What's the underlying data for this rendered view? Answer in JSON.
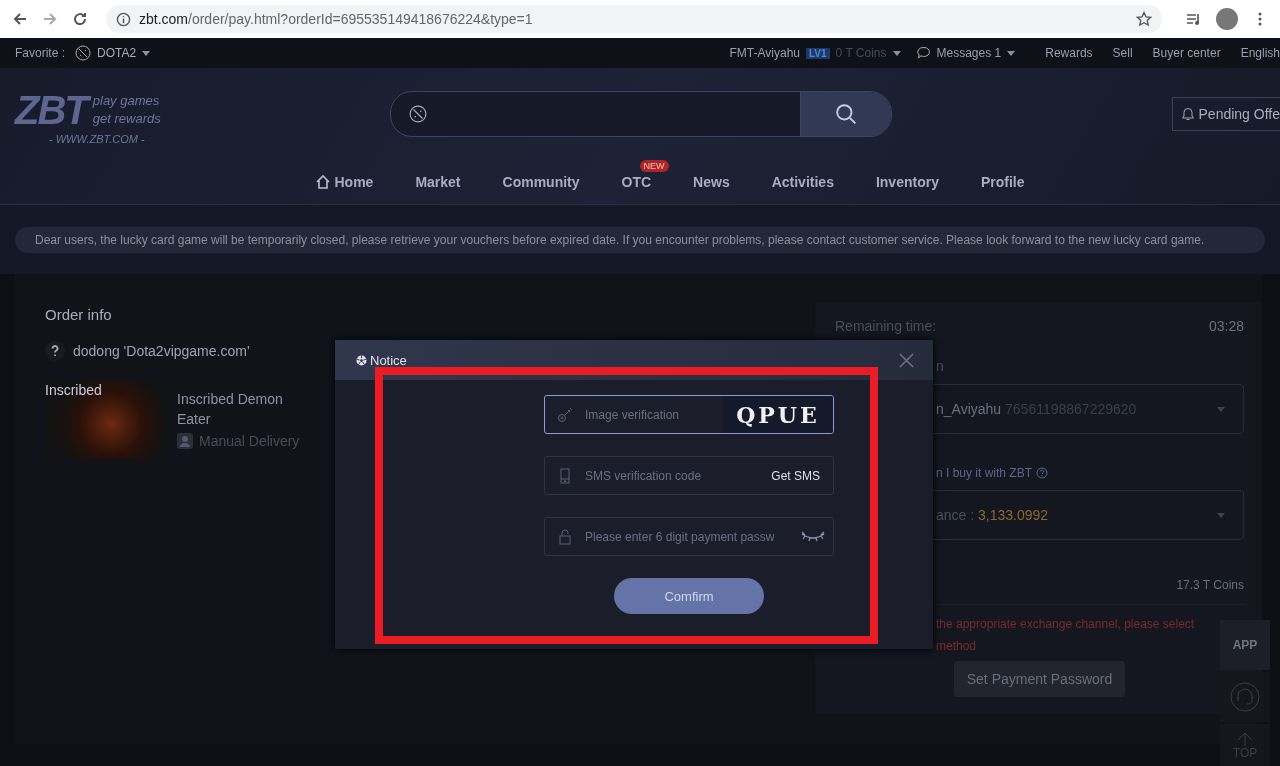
{
  "browser": {
    "url_host": "zbt.com",
    "url_path": "/order/pay.html?orderId=695535149418676224&type=1"
  },
  "topbar": {
    "favorite_label": "Favorite :",
    "game": "DOTA2",
    "user": "FMT-Aviyahu",
    "level_badge": "LV1",
    "coins": "0 T Coins",
    "messages": "Messages 1",
    "links": [
      "Rewards",
      "Sell",
      "Buyer center",
      "English"
    ]
  },
  "header": {
    "logo": "ZBT",
    "tagline": [
      "play games",
      "get rewards"
    ],
    "site": "- WWW.ZBT.COM -",
    "pending": "Pending Offe"
  },
  "nav": [
    {
      "kind": "home",
      "label": "Home"
    },
    {
      "kind": "plain",
      "label": "Market"
    },
    {
      "kind": "plain",
      "label": "Community"
    },
    {
      "kind": "plain",
      "label": "OTC",
      "badge": "NEW"
    },
    {
      "kind": "plain",
      "label": "News"
    },
    {
      "kind": "plain",
      "label": "Activities"
    },
    {
      "kind": "plain",
      "label": "Inventory"
    },
    {
      "kind": "plain",
      "label": "Profile"
    }
  ],
  "notice_bar": "Dear users, the lucky card game will be temporarily closed, please retrieve your vouchers before expired date. If you encounter problems, please contact customer service. Please look forward to the new lucky card game.",
  "order": {
    "title": "Order info",
    "seller": "dodong 'Dota2vipgame.com'",
    "item_tag": "Inscribed",
    "item_name": "Inscribed Demon Eater",
    "delivery": "Manual Delivery"
  },
  "payment": {
    "remaining_label": "Remaining time:",
    "remaining": "03:28",
    "label_partial": "n",
    "account_name": "n_Aviyahu",
    "account_id": "76561198867229620",
    "question": "n I buy it with ZBT",
    "balance_label": "ance :",
    "balance": "3,133.0992",
    "price": "17.3 T Coins",
    "warning": [
      "the appropriate exchange channel, please select",
      "method"
    ],
    "set_password": "Set Payment Password"
  },
  "side": {
    "app": "APP",
    "top": "TOP"
  },
  "modal": {
    "title": "Notice",
    "fields": [
      {
        "kind": "captcha",
        "placeholder": "Image verification",
        "captcha": "QPUE",
        "focused": true
      },
      {
        "kind": "sms",
        "placeholder": "SMS verification code",
        "action": "Get SMS",
        "focused": false
      },
      {
        "kind": "password",
        "placeholder": "Please enter 6 digit payment passw",
        "focused": false
      }
    ],
    "confirm": "Comfirm"
  }
}
